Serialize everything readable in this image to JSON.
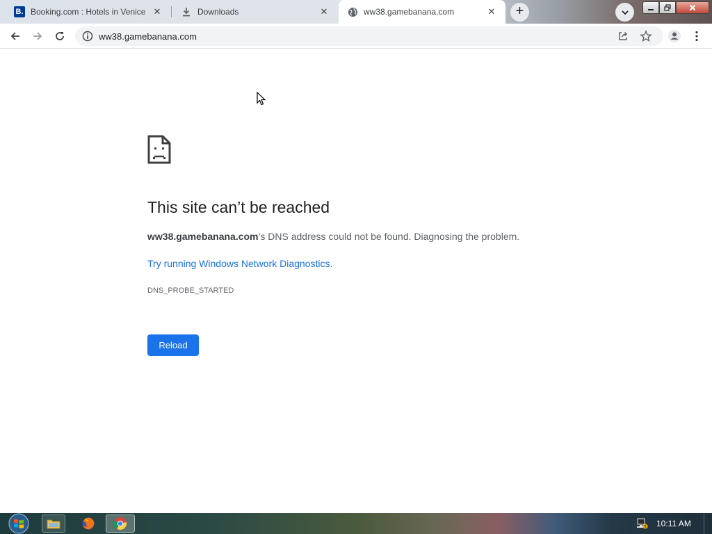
{
  "tabs": [
    {
      "title": "Booking.com : Hotels in Venice",
      "icon": "booking-favicon",
      "badge": "B.",
      "active": false
    },
    {
      "title": "Downloads",
      "icon": "download-icon",
      "active": false
    },
    {
      "title": "ww38.gamebanana.com",
      "icon": "globe-icon",
      "active": true
    }
  ],
  "toolbar": {
    "url": "ww38.gamebanana.com"
  },
  "error_page": {
    "title": "This site can’t be reached",
    "host": "ww38.gamebanana.com",
    "message_rest": "’s DNS address could not be found. Diagnosing the problem.",
    "link_text": "Try running Windows Network Diagnostics",
    "link_suffix": ".",
    "error_code": "DNS_PROBE_STARTED",
    "reload_label": "Reload"
  },
  "taskbar": {
    "clock": "10:11 AM",
    "apps": [
      "windows-explorer",
      "firefox",
      "chrome"
    ]
  },
  "colors": {
    "accent": "#1a73e8",
    "booking_brand": "#003b95",
    "title_text": "#202124",
    "body_text": "#5f6368"
  }
}
